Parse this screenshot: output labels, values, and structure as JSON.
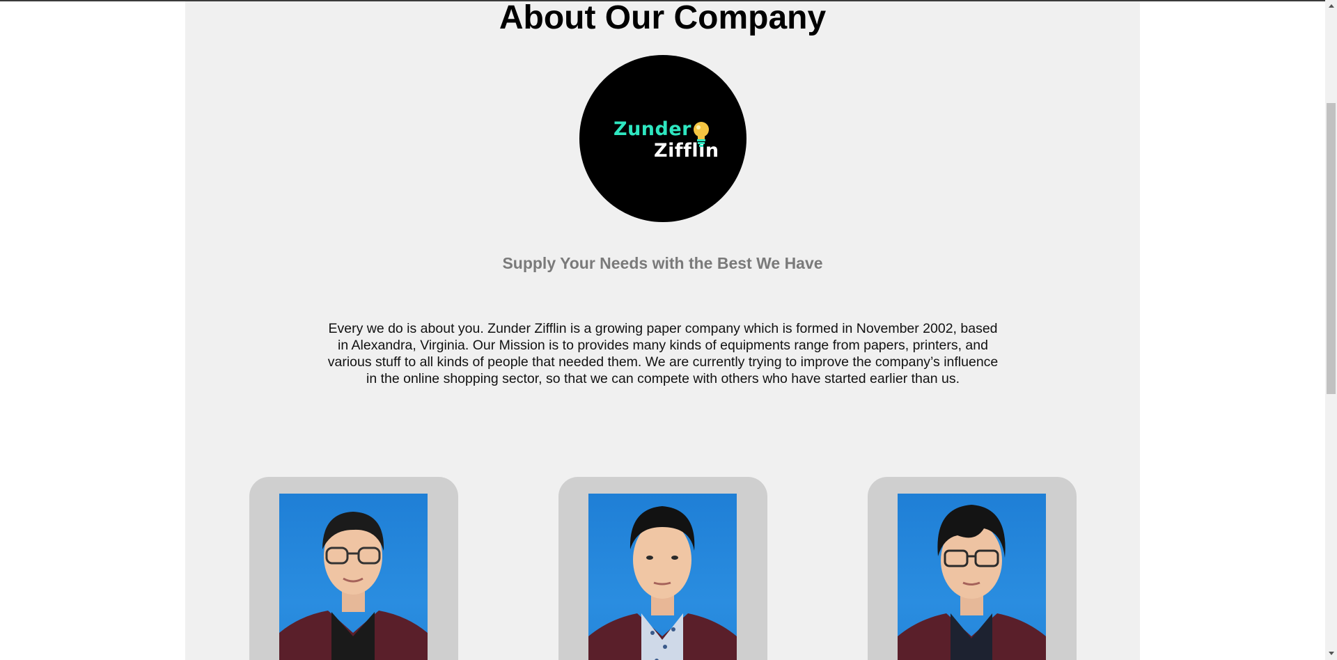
{
  "page": {
    "title": "About Our Company",
    "tagline": "Supply Your Needs with the Best We Have",
    "description": "Every we do is about you. Zunder Zifflin is a growing paper company which is formed in November 2002, based in Alexandra, Virginia. Our Mission is to provides many kinds of equipments range from papers, printers, and various stuff to all kinds of people that needed them. We are currently trying to improve the company’s influence in the online shopping sector, so that we can compete with others who have started earlier than us."
  },
  "logo": {
    "line1": "Zunder",
    "line2": "Zifflin",
    "icon": "lightbulb-icon",
    "colors": {
      "background": "#000000",
      "line1": "#2ee6c0",
      "line2": "#ffffff",
      "bulb": "#f5c542"
    }
  },
  "team": [
    {
      "photo": "team-member-photo",
      "attire": "maroon blazer, black shirt, glasses"
    },
    {
      "photo": "team-member-photo",
      "attire": "maroon blazer, patterned shirt"
    },
    {
      "photo": "team-member-photo",
      "attire": "maroon blazer, dark shirt, glasses"
    }
  ],
  "colors": {
    "page_background": "#f0f0f0",
    "card_background": "#cfcfcf",
    "photo_background": "#2383d8",
    "tagline": "#7a7a7a",
    "blazer": "#5a1f2a"
  }
}
